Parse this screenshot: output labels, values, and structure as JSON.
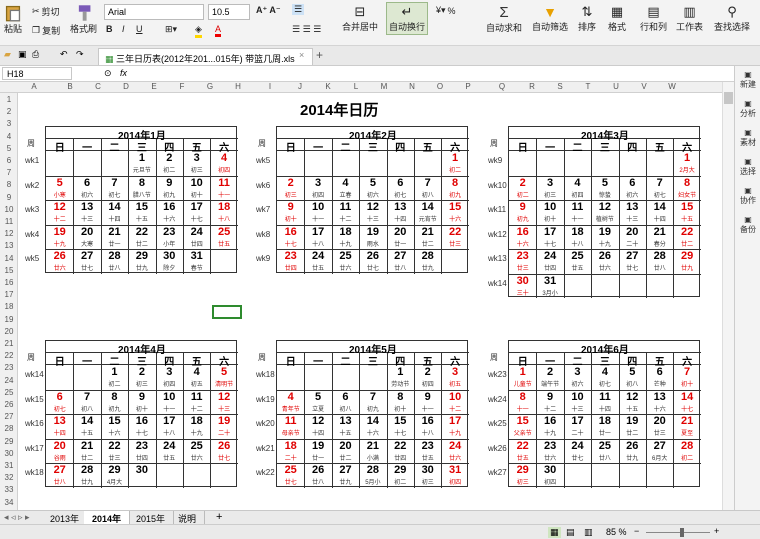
{
  "toolbar": {
    "paste": "粘贴",
    "cut": "剪切",
    "copy": "复制",
    "format_painter": "格式刷",
    "font": "Arial",
    "size": "10.5",
    "merge": "合并居中",
    "wrap": "自动换行",
    "percent": "%",
    "autosum": "自动求和",
    "autofilter": "自动筛选",
    "sort": "排序",
    "format": "格式",
    "rowcol": "行和列",
    "worksheet": "工作表",
    "findselect": "查找选择"
  },
  "document": {
    "tab_title": "三年日历表(2012年201...015年) 带篮几周.xls"
  },
  "formula": {
    "name_box": "H18",
    "fx": "fx"
  },
  "columns": [
    "A",
    "B",
    "C",
    "D",
    "E",
    "F",
    "G",
    "H",
    "I",
    "J",
    "K",
    "L",
    "M",
    "N",
    "O",
    "P",
    "Q",
    "R",
    "S",
    "T",
    "U",
    "V",
    "W"
  ],
  "rows": [
    "1",
    "2",
    "3",
    "4",
    "5",
    "6",
    "7",
    "8",
    "9",
    "10",
    "11",
    "12",
    "13",
    "14",
    "15",
    "16",
    "17",
    "18",
    "19",
    "20",
    "21",
    "22",
    "23",
    "24",
    "25",
    "26",
    "27",
    "28",
    "29",
    "30",
    "31",
    "32",
    "33",
    "34"
  ],
  "sidebar": [
    "新建",
    "分析",
    "素材",
    "选择",
    "协作",
    "备份"
  ],
  "sheet_tabs": [
    "2013年",
    "2014年",
    "2015年",
    "说明"
  ],
  "status": {
    "zoom": "85 %"
  },
  "calendar": {
    "title": "2014年日历",
    "week_label": "周",
    "weekdays": [
      "日",
      "一",
      "二",
      "三",
      "四",
      "五",
      "六"
    ],
    "months": [
      {
        "name": "2014年1月",
        "weeks": [
          "wk1",
          "wk2",
          "wk3",
          "wk4",
          "wk5"
        ],
        "rows": [
          [
            "",
            "",
            "",
            "1",
            "2",
            "3",
            "4"
          ],
          [
            "5",
            "6",
            "7",
            "8",
            "9",
            "10",
            "11"
          ],
          [
            "12",
            "13",
            "14",
            "15",
            "16",
            "17",
            "18"
          ],
          [
            "19",
            "20",
            "21",
            "22",
            "23",
            "24",
            "25"
          ],
          [
            "26",
            "27",
            "28",
            "29",
            "30",
            "31",
            ""
          ]
        ],
        "lunar": [
          [
            "",
            "",
            "",
            "元旦节",
            "初二",
            "初三",
            "初四"
          ],
          [
            "小寒",
            "初六",
            "初七",
            "腊八节",
            "初九",
            "初十",
            "十一"
          ],
          [
            "十二",
            "十三",
            "十四",
            "十五",
            "十六",
            "十七",
            "十八"
          ],
          [
            "十九",
            "大寒",
            "廿一",
            "廿二",
            "小年",
            "廿四",
            "廿五"
          ],
          [
            "廿六",
            "廿七",
            "廿八",
            "廿九",
            "除夕",
            "春节",
            ""
          ]
        ]
      },
      {
        "name": "2014年2月",
        "weeks": [
          "wk5",
          "wk6",
          "wk7",
          "wk8",
          "wk9"
        ],
        "rows": [
          [
            "",
            "",
            "",
            "",
            "",
            "",
            "1"
          ],
          [
            "2",
            "3",
            "4",
            "5",
            "6",
            "7",
            "8"
          ],
          [
            "9",
            "10",
            "11",
            "12",
            "13",
            "14",
            "15"
          ],
          [
            "16",
            "17",
            "18",
            "19",
            "20",
            "21",
            "22"
          ],
          [
            "23",
            "24",
            "25",
            "26",
            "27",
            "28",
            ""
          ]
        ],
        "lunar": [
          [
            "",
            "",
            "",
            "",
            "",
            "",
            "初二"
          ],
          [
            "初三",
            "初四",
            "立春",
            "初六",
            "初七",
            "初八",
            "初九"
          ],
          [
            "初十",
            "十一",
            "十二",
            "十三",
            "十四",
            "元宵节",
            "十六"
          ],
          [
            "十七",
            "十八",
            "十九",
            "雨水",
            "廿一",
            "廿二",
            "廿三"
          ],
          [
            "廿四",
            "廿五",
            "廿六",
            "廿七",
            "廿八",
            "廿九",
            ""
          ]
        ]
      },
      {
        "name": "2014年3月",
        "weeks": [
          "wk9",
          "wk10",
          "wk11",
          "wk12",
          "wk13",
          "wk14"
        ],
        "rows": [
          [
            "",
            "",
            "",
            "",
            "",
            "",
            "1"
          ],
          [
            "2",
            "3",
            "4",
            "5",
            "6",
            "7",
            "8"
          ],
          [
            "9",
            "10",
            "11",
            "12",
            "13",
            "14",
            "15"
          ],
          [
            "16",
            "17",
            "18",
            "19",
            "20",
            "21",
            "22"
          ],
          [
            "23",
            "24",
            "25",
            "26",
            "27",
            "28",
            "29"
          ],
          [
            "30",
            "31",
            "",
            "",
            "",
            "",
            ""
          ]
        ],
        "lunar": [
          [
            "",
            "",
            "",
            "",
            "",
            "",
            "2月大"
          ],
          [
            "初二",
            "初三",
            "初四",
            "惊蛰",
            "初六",
            "初七",
            "妇女节"
          ],
          [
            "初九",
            "初十",
            "十一",
            "植树节",
            "十三",
            "十四",
            "十五"
          ],
          [
            "十六",
            "十七",
            "十八",
            "十九",
            "二十",
            "春分",
            "廿二"
          ],
          [
            "廿三",
            "廿四",
            "廿五",
            "廿六",
            "廿七",
            "廿八",
            "廿九"
          ],
          [
            "三十",
            "3月小",
            "",
            "",
            "",
            "",
            ""
          ]
        ]
      },
      {
        "name": "2014年4月",
        "weeks": [
          "wk14",
          "wk15",
          "wk16",
          "wk17",
          "wk18"
        ],
        "rows": [
          [
            "",
            "",
            "1",
            "2",
            "3",
            "4",
            "5"
          ],
          [
            "6",
            "7",
            "8",
            "9",
            "10",
            "11",
            "12"
          ],
          [
            "13",
            "14",
            "15",
            "16",
            "17",
            "18",
            "19"
          ],
          [
            "20",
            "21",
            "22",
            "23",
            "24",
            "25",
            "26"
          ],
          [
            "27",
            "28",
            "29",
            "30",
            "",
            "",
            ""
          ]
        ],
        "lunar": [
          [
            "",
            "",
            "初二",
            "初三",
            "初四",
            "初五",
            "清明节"
          ],
          [
            "初七",
            "初八",
            "初九",
            "初十",
            "十一",
            "十二",
            "十三"
          ],
          [
            "十四",
            "十五",
            "十六",
            "十七",
            "十八",
            "十九",
            "二十"
          ],
          [
            "谷雨",
            "廿二",
            "廿三",
            "廿四",
            "廿五",
            "廿六",
            "廿七"
          ],
          [
            "廿八",
            "廿九",
            "4月大",
            "",
            "",
            "",
            ""
          ]
        ]
      },
      {
        "name": "2014年5月",
        "weeks": [
          "wk18",
          "wk19",
          "wk20",
          "wk21",
          "wk22"
        ],
        "rows": [
          [
            "",
            "",
            "",
            "",
            "1",
            "2",
            "3"
          ],
          [
            "4",
            "5",
            "6",
            "7",
            "8",
            "9",
            "10"
          ],
          [
            "11",
            "12",
            "13",
            "14",
            "15",
            "16",
            "17"
          ],
          [
            "18",
            "19",
            "20",
            "21",
            "22",
            "23",
            "24"
          ],
          [
            "25",
            "26",
            "27",
            "28",
            "29",
            "30",
            "31"
          ]
        ],
        "lunar": [
          [
            "",
            "",
            "",
            "",
            "劳动节",
            "初四",
            "初五"
          ],
          [
            "青年节",
            "立夏",
            "初八",
            "初九",
            "初十",
            "十一",
            "十二"
          ],
          [
            "母亲节",
            "十四",
            "十五",
            "十六",
            "十七",
            "十八",
            "十九"
          ],
          [
            "二十",
            "廿一",
            "廿二",
            "小满",
            "廿四",
            "廿五",
            "廿六"
          ],
          [
            "廿七",
            "廿八",
            "廿九",
            "5月小",
            "初二",
            "初三",
            "初四"
          ]
        ]
      },
      {
        "name": "2014年6月",
        "weeks": [
          "wk23",
          "wk24",
          "wk25",
          "wk26",
          "wk27"
        ],
        "rows": [
          [
            "1",
            "2",
            "3",
            "4",
            "5",
            "6",
            "7"
          ],
          [
            "8",
            "9",
            "10",
            "11",
            "12",
            "13",
            "14"
          ],
          [
            "15",
            "16",
            "17",
            "18",
            "19",
            "20",
            "21"
          ],
          [
            "22",
            "23",
            "24",
            "25",
            "26",
            "27",
            "28"
          ],
          [
            "29",
            "30",
            "",
            "",
            "",
            "",
            ""
          ]
        ],
        "lunar": [
          [
            "儿童节",
            "端午节",
            "初六",
            "初七",
            "初八",
            "芒种",
            "初十"
          ],
          [
            "十一",
            "十二",
            "十三",
            "十四",
            "十五",
            "十六",
            "十七"
          ],
          [
            "父亲节",
            "十九",
            "二十",
            "廿一",
            "廿二",
            "廿三",
            "夏至"
          ],
          [
            "廿五",
            "廿六",
            "廿七",
            "廿八",
            "廿九",
            "6月大",
            "初二"
          ],
          [
            "初三",
            "初四",
            "",
            "",
            "",
            "",
            ""
          ]
        ]
      }
    ]
  }
}
